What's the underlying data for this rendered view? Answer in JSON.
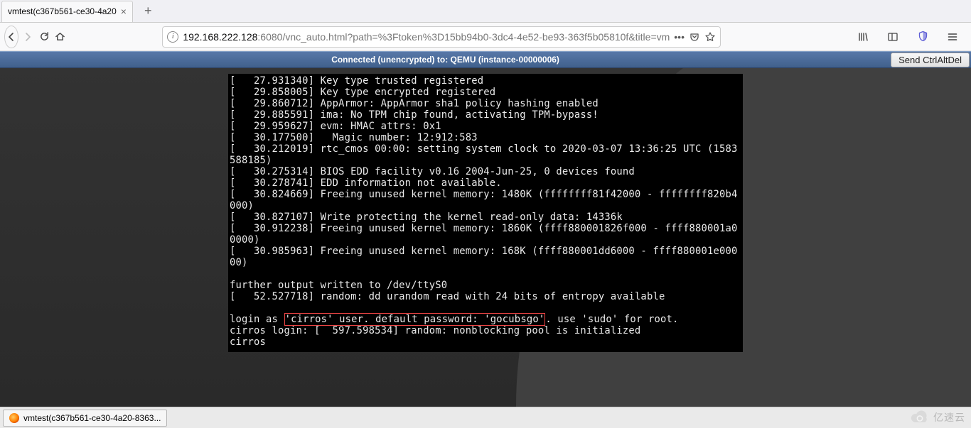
{
  "tab": {
    "title": "vmtest(c367b561-ce30-4a20"
  },
  "url": {
    "scheme_host": "192.168.222.128",
    "rest": ":6080/vnc_auto.html?path=%3Ftoken%3D15bb94b0-3dc4-4e52-be93-363f5b05810f&title=vm"
  },
  "status": {
    "text": "Connected (unencrypted) to: QEMU (instance-00000006)",
    "button": "Send CtrlAltDel"
  },
  "terminal": {
    "lines_pre": "[   27.931340] Key type trusted registered\n[   29.858005] Key type encrypted registered\n[   29.860712] AppArmor: AppArmor sha1 policy hashing enabled\n[   29.885591] ima: No TPM chip found, activating TPM-bypass!\n[   29.959627] evm: HMAC attrs: 0x1\n[   30.177500]   Magic number: 12:912:583\n[   30.212019] rtc_cmos 00:00: setting system clock to 2020-03-07 13:36:25 UTC (1583588185)\n[   30.275314] BIOS EDD facility v0.16 2004-Jun-25, 0 devices found\n[   30.278741] EDD information not available.\n[   30.824669] Freeing unused kernel memory: 1480K (ffffffff81f42000 - ffffffff820b4000)\n[   30.827107] Write protecting the kernel read-only data: 14336k\n[   30.912238] Freeing unused kernel memory: 1860K (ffff880001826f000 - ffff880001a00000)\n[   30.985963] Freeing unused kernel memory: 168K (ffff880001dd6000 - ffff880001e00000)\n\nfurther output written to /dev/ttyS0\n[   52.527718] random: dd urandom read with 24 bits of entropy available\n\n",
    "login_prefix": "login as ",
    "login_hl": "'cirros' user. default password: 'gocubsgo'",
    "login_suffix": ". use 'sudo' for root.",
    "post": "cirros login: [  597.598534] random: nonblocking pool is initialized\ncirros"
  },
  "taskbar": {
    "title": "vmtest(c367b561-ce30-4a20-8363..."
  },
  "watermark": {
    "text": "亿速云"
  }
}
